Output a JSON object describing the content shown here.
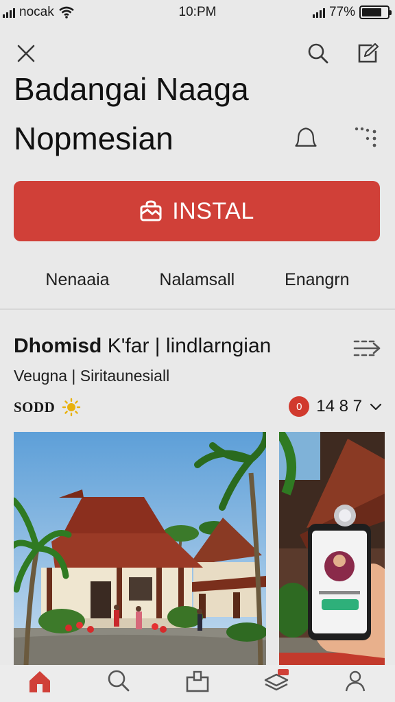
{
  "status": {
    "carrier": "nocak",
    "time": "10:PM",
    "battery_label": "77%",
    "battery_level": 0.77
  },
  "header": {
    "close_icon": "close-icon",
    "search_icon": "search-icon",
    "edit_icon": "edit-icon"
  },
  "app": {
    "title_line1": "Badangai Naaga",
    "title_line2": "Nopmesian",
    "install_label": "INSTAL",
    "tabs": [
      {
        "label": "Nenaaia"
      },
      {
        "label": "Nalamsall"
      },
      {
        "label": "Enangrn"
      }
    ]
  },
  "details": {
    "name_bold": "Dhomisd",
    "name_rest": "K'far | lindlarngian",
    "subtitle": "Veugna | Siritaunesiall",
    "rating_label": "SODD",
    "badge_value": "0",
    "count": "14 8 7"
  },
  "colors": {
    "accent": "#d04038",
    "background": "#e9e9e9"
  }
}
